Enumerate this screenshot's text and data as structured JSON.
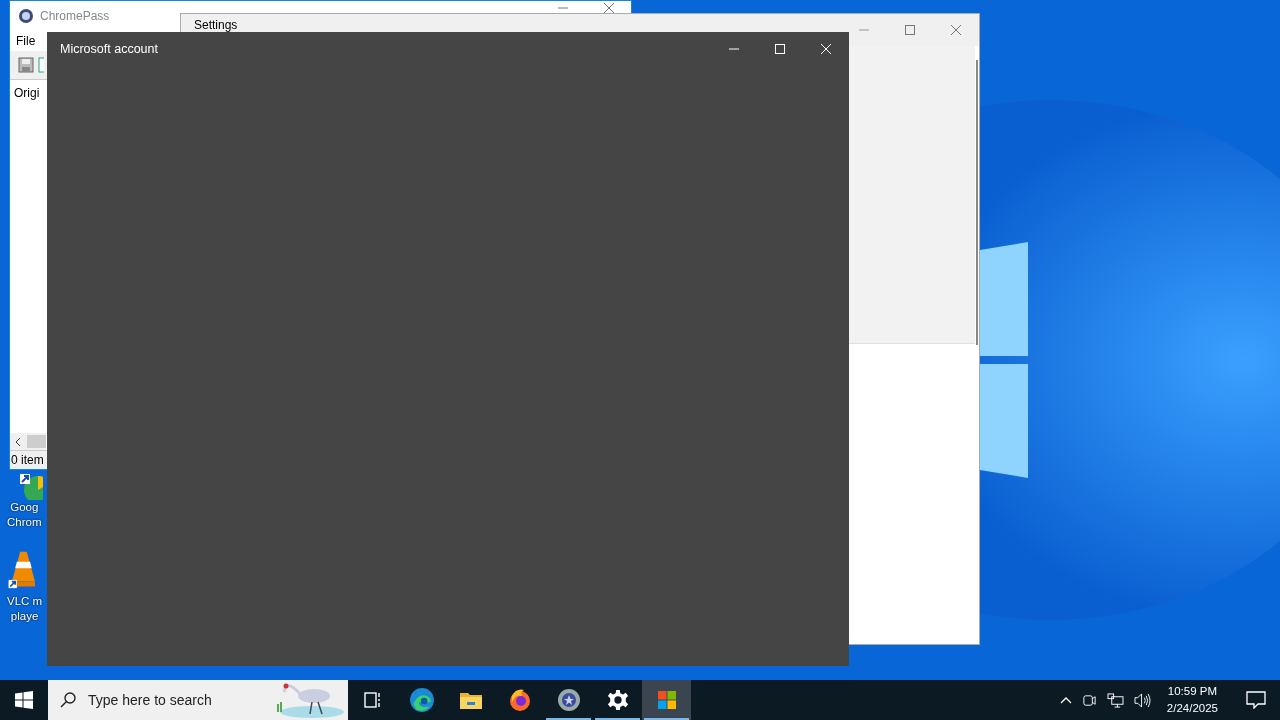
{
  "desktop_icons": [
    {
      "kind": "chrome",
      "label_lines": [
        "Goog",
        "Chrom"
      ]
    },
    {
      "kind": "vlc",
      "label_lines": [
        "VLC m",
        "playe"
      ]
    }
  ],
  "chromepass_window": {
    "title": "ChromePass",
    "menu": [
      "File"
    ],
    "column_header": "Origi",
    "status": "0 item"
  },
  "settings_window": {
    "title": "Settings"
  },
  "account_window": {
    "title": "Microsoft account"
  },
  "taskbar": {
    "search": {
      "placeholder": "Type here to search"
    },
    "apps": [
      {
        "kind": "task-view",
        "running": false,
        "selected": false
      },
      {
        "kind": "edge",
        "running": false,
        "selected": false
      },
      {
        "kind": "explorer",
        "running": false,
        "selected": false
      },
      {
        "kind": "firefox",
        "running": false,
        "selected": false
      },
      {
        "kind": "chromepass",
        "running": true,
        "selected": false
      },
      {
        "kind": "settings",
        "running": true,
        "selected": false
      },
      {
        "kind": "store",
        "running": true,
        "selected": true
      }
    ],
    "time": "10:59 PM",
    "date": "2/24/2025"
  }
}
